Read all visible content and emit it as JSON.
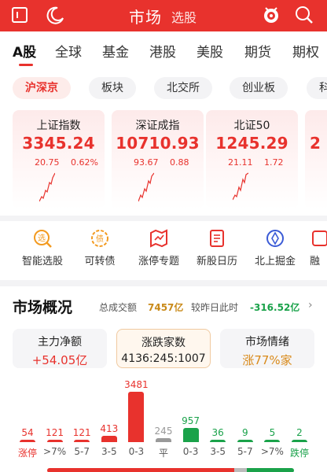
{
  "header": {
    "title": "市场",
    "subtitle": "选股"
  },
  "tabs": [
    "A股",
    "全球",
    "基金",
    "港股",
    "美股",
    "期货",
    "期权"
  ],
  "subtabs": [
    "沪深京",
    "板块",
    "北交所",
    "创业板",
    "科"
  ],
  "indices": [
    {
      "name": "上证指数",
      "value": "3345.24",
      "change": "20.75",
      "pct": "0.62%"
    },
    {
      "name": "深证成指",
      "value": "10710.93",
      "change": "93.67",
      "pct": "0.88"
    },
    {
      "name": "北证50",
      "value": "1245.29",
      "change": "21.11",
      "pct": "1.72"
    }
  ],
  "shortcuts": [
    "智能选股",
    "可转债",
    "涨停专题",
    "新股日历",
    "北上掘金",
    "融"
  ],
  "overview": {
    "title": "市场概况",
    "turnover_label": "总成交额",
    "turnover_value": "7457亿",
    "compare_label": "较昨日此时",
    "compare_value": "-316.52亿",
    "chevron": "›",
    "stats": [
      {
        "label": "主力净额",
        "value": "+54.05亿"
      },
      {
        "label": "涨跌家数",
        "value": "4136:245:1007"
      },
      {
        "label": "市场情绪",
        "value": "涨77%家"
      }
    ]
  },
  "distribution": [
    {
      "label": "涨停",
      "value": "54",
      "count": 54,
      "color": "#e8322d"
    },
    {
      "label": ">7%",
      "value": "121",
      "count": 121,
      "color": "#e8322d"
    },
    {
      "label": "5-7",
      "value": "121",
      "count": 121,
      "color": "#e8322d"
    },
    {
      "label": "3-5",
      "value": "413",
      "count": 413,
      "color": "#e8322d"
    },
    {
      "label": "0-3",
      "value": "3481",
      "count": 3481,
      "color": "#e8322d"
    },
    {
      "label": "平",
      "value": "245",
      "count": 245,
      "color": "#999999"
    },
    {
      "label": "0-3",
      "value": "957",
      "count": 957,
      "color": "#1aa24a"
    },
    {
      "label": "3-5",
      "value": "36",
      "count": 36,
      "color": "#1aa24a"
    },
    {
      "label": "5-7",
      "value": "9",
      "count": 9,
      "color": "#1aa24a"
    },
    {
      "label": ">7%",
      "value": "5",
      "count": 5,
      "color": "#1aa24a"
    },
    {
      "label": "跌停",
      "value": "2",
      "count": 2,
      "color": "#1aa24a"
    }
  ],
  "colors": {
    "brand_red": "#e8322d",
    "down_green": "#1aa24a",
    "flat_gray": "#999999"
  }
}
